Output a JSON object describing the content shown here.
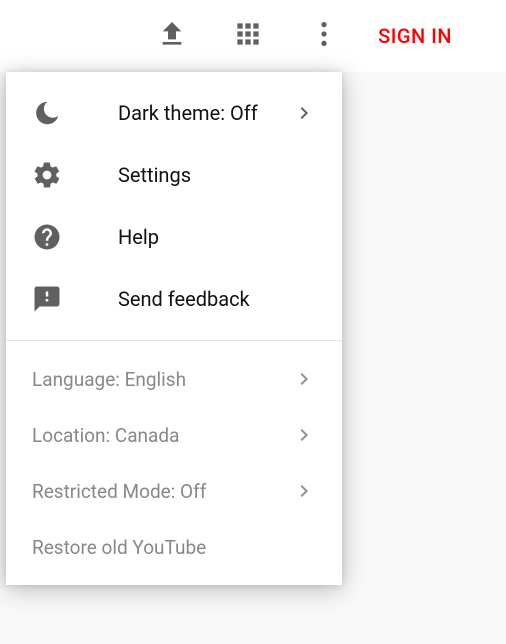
{
  "header": {
    "signin_label": "SIGN IN"
  },
  "menu": {
    "dark_theme": {
      "label": "Dark theme: Off"
    },
    "settings": {
      "label": "Settings"
    },
    "help": {
      "label": "Help"
    },
    "feedback": {
      "label": "Send feedback"
    }
  },
  "submenu": {
    "language": {
      "label": "Language: English"
    },
    "location": {
      "label": "Location: Canada"
    },
    "restricted": {
      "label": "Restricted Mode: Off"
    },
    "restore": {
      "label": "Restore old YouTube"
    }
  }
}
